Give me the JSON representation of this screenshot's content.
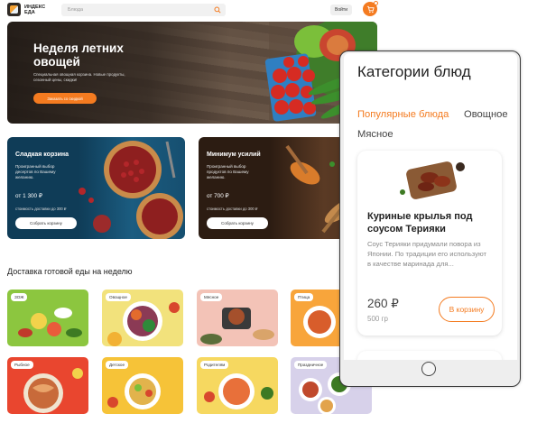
{
  "header": {
    "logo_text": "ИНДЕКС ЕДА",
    "search_placeholder": "Блюда",
    "login_label": "Войти"
  },
  "hero": {
    "title": "Неделя летних овощей",
    "subtitle": "Специальная овощная корзина. Новые продукты, сезонный цены, скидки!",
    "button_label": "Заказать со скидкой"
  },
  "promos": [
    {
      "title": "Сладкая корзина",
      "description": "Проигранный выбор десертов по Вашему желанию.",
      "price": "от 1 300 ₽",
      "delivery": "стоимость доставки до 300 ₽",
      "button_label": "Собрать корзину"
    },
    {
      "title": "Минимум усилий",
      "description": "Проигранный выбор продуктов по Вашему желанию.",
      "price": "от 700 ₽",
      "delivery": "стоимость доставки до 300 ₽",
      "button_label": "Собрать корзину"
    }
  ],
  "section": {
    "title": "Доставка готовой еды на неделю"
  },
  "tiles": [
    {
      "label": "ЗОЖ",
      "bg": "#8cc63f"
    },
    {
      "label": "Овощное",
      "bg": "#f2e27c"
    },
    {
      "label": "Мясное",
      "bg": "#f3c3b7"
    },
    {
      "label": "Птица",
      "bg": "#f8a53b"
    },
    {
      "label": "Рыбное",
      "bg": "#e9462f"
    },
    {
      "label": "Детское",
      "bg": "#f6c338"
    },
    {
      "label": "Родителям",
      "bg": "#f6d860"
    },
    {
      "label": "Праздничное",
      "bg": "#d7d1ea"
    }
  ],
  "phone": {
    "title": "Категории блюд",
    "tabs": [
      "Популярные блюда",
      "Овощное",
      "Мясное"
    ],
    "active_tab": "Популярные блюда",
    "card": {
      "name": "Куриные крылья под соусом Терияки",
      "description": "Соус Терияки придумали повора из Японии. По традиции его используют в качестве маринада для...",
      "price": "260 ₽",
      "weight": "500 гр",
      "button_label": "В корзину"
    }
  },
  "colors": {
    "accent": "#f47b20"
  }
}
